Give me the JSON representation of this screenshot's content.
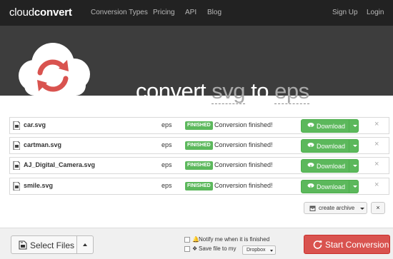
{
  "nav": {
    "brand_light": "cloud",
    "brand_bold": "convert",
    "links": [
      "Conversion Types",
      "Pricing",
      "API",
      "Blog"
    ],
    "sign_up": "Sign Up",
    "login": "Login"
  },
  "hero": {
    "word1": "convert",
    "from_format": "svg",
    "word2": "to",
    "to_format": "eps"
  },
  "files": [
    {
      "name": "car.svg",
      "format": "eps",
      "status_badge": "FINISHED",
      "status_text": "Conversion finished!",
      "download_label": "Download"
    },
    {
      "name": "cartman.svg",
      "format": "eps",
      "status_badge": "FINISHED",
      "status_text": "Conversion finished!",
      "download_label": "Download"
    },
    {
      "name": "AJ_Digital_Camera.svg",
      "format": "eps",
      "status_badge": "FINISHED",
      "status_text": "Conversion finished!",
      "download_label": "Download"
    },
    {
      "name": "smile.svg",
      "format": "eps",
      "status_badge": "FINISHED",
      "status_text": "Conversion finished!",
      "download_label": "Download"
    }
  ],
  "archive": {
    "label": "create archive",
    "close": "×"
  },
  "remove_symbol": "×",
  "bottom": {
    "select_files": "Select Files",
    "notify": "Notify me when it is finished",
    "save_file": "Save file to my",
    "dropbox": "Dropbox",
    "start": "Start Conversion"
  },
  "colors": {
    "nav_bg": "#222222",
    "hero_bg": "#3d3d3d",
    "success": "#5cb85c",
    "danger": "#d9534f",
    "logo_red": "#d9534f"
  },
  "icons": [
    "file-icon",
    "cloud-icon",
    "download-icon",
    "archive-icon",
    "select-files-icon",
    "bell-icon",
    "dropbox-icon",
    "refresh-icon"
  ]
}
